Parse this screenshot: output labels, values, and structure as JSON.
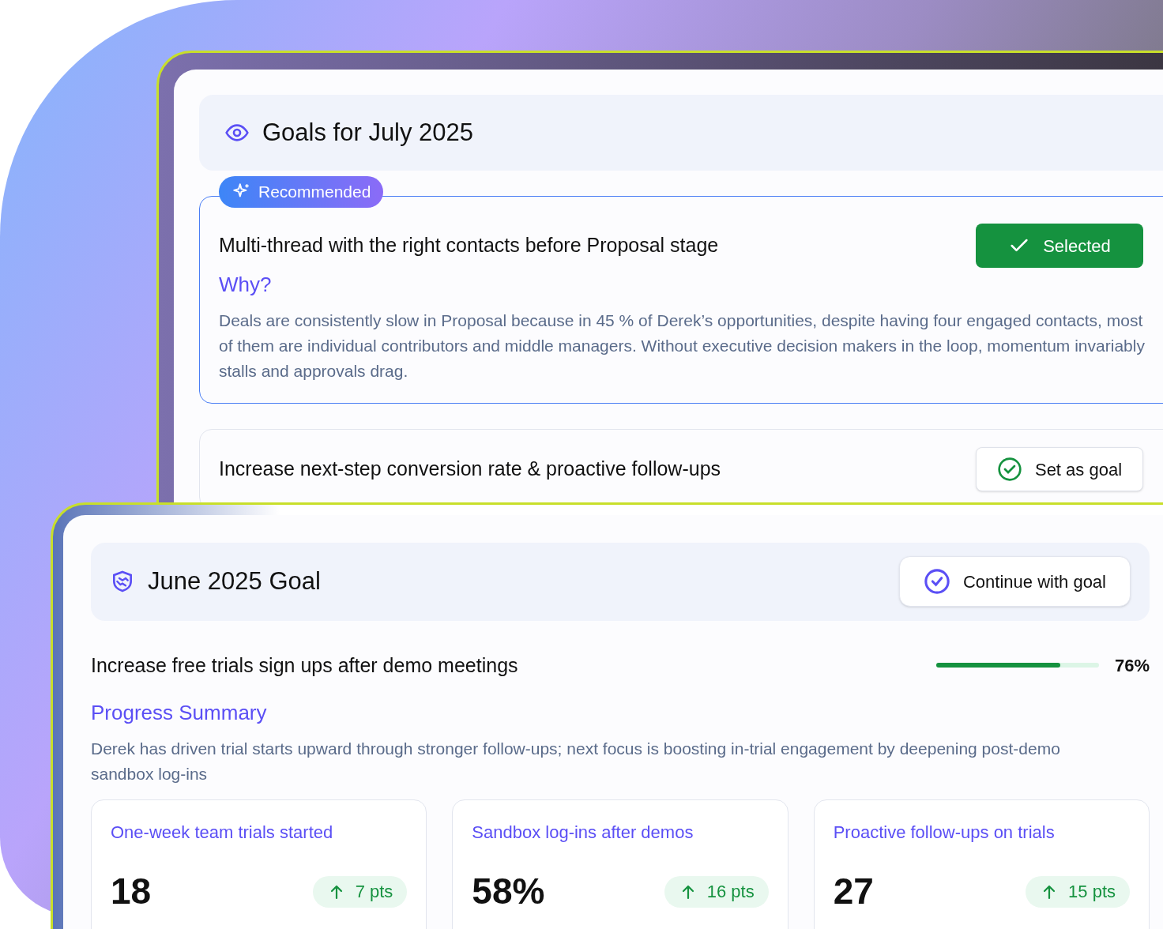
{
  "july": {
    "title": "Goals for July 2025",
    "goals": [
      {
        "badge": "Recommended",
        "title": "Multi-thread with the right contacts before Proposal stage",
        "why_label": "Why?",
        "why_text": "Deals are consistently slow in Proposal because in 45 % of Derek’s opportunities, despite having four engaged contacts, most of them are individual contributors and middle managers. Without executive decision makers in the loop, momentum invariably stalls and approvals drag.",
        "button": "Selected",
        "selected": true
      },
      {
        "title": "Increase next-step conversion rate & proactive follow-ups",
        "button": "Set as goal",
        "selected": false
      }
    ]
  },
  "june": {
    "title": "June 2025 Goal",
    "button": "Continue with goal",
    "goal": "Increase free trials sign ups after demo meetings",
    "level": 0.76,
    "percent": "76%",
    "summary_label": "Progress Summary",
    "summary": "Derek has driven trial starts upward through stronger follow-ups; next focus is boosting in-trial engagement by deepening post-demo sandbox log-ins",
    "metrics": [
      {
        "label": "One-week team trials started",
        "value": "18",
        "delta": "7 pts"
      },
      {
        "label": "Sandbox log-ins after demos",
        "value": "58%",
        "delta": "16 pts"
      },
      {
        "label": "Proactive follow-ups on trials",
        "value": "27",
        "delta": "15 pts"
      }
    ]
  }
}
